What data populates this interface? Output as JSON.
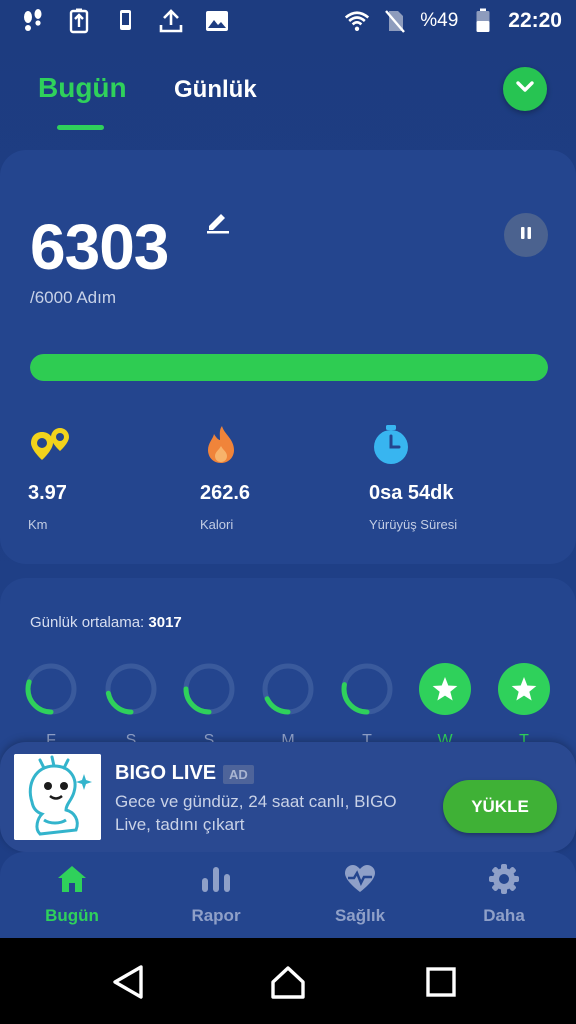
{
  "status_bar": {
    "battery_percent": "%49",
    "time": "22:20",
    "icons": [
      "footsteps-icon",
      "battery-saver-icon",
      "device-icon",
      "upload-icon",
      "image-icon",
      "wifi-icon",
      "no-sim-icon",
      "battery-icon"
    ]
  },
  "tabs": {
    "today": "Bugün",
    "daily": "Günlük"
  },
  "steps": {
    "value": "6303",
    "goal": "/6000 Adım",
    "progress_fraction": 1.0
  },
  "stats": {
    "distance": {
      "value": "3.97",
      "label": "Km",
      "icon": "location-pins-icon"
    },
    "calories": {
      "value": "262.6",
      "label": "Kalori",
      "icon": "flame-icon"
    },
    "walk_time": {
      "value": "0sa 54dk",
      "label": "Yürüyüş Süresi",
      "icon": "stopwatch-icon"
    }
  },
  "average": {
    "label": "Günlük ortalama:",
    "value": "3017"
  },
  "week": [
    {
      "letter": "F",
      "fraction": 0.3,
      "complete": false
    },
    {
      "letter": "S",
      "fraction": 0.22,
      "complete": false
    },
    {
      "letter": "S",
      "fraction": 0.25,
      "complete": false
    },
    {
      "letter": "M",
      "fraction": 0.18,
      "complete": false
    },
    {
      "letter": "T",
      "fraction": 0.28,
      "complete": false
    },
    {
      "letter": "W",
      "fraction": 1.0,
      "complete": true
    },
    {
      "letter": "T",
      "fraction": 1.0,
      "complete": true
    }
  ],
  "ad": {
    "title": "BIGO LIVE",
    "badge": "AD",
    "description": "Gece ve gündüz, 24 saat canlı, BIGO Live, tadını çıkart",
    "cta": "YÜKLE"
  },
  "bottom_nav": [
    {
      "label": "Bugün",
      "icon": "home-icon",
      "active": true
    },
    {
      "label": "Rapor",
      "icon": "bar-chart-icon",
      "active": false
    },
    {
      "label": "Sağlık",
      "icon": "heart-pulse-icon",
      "active": false
    },
    {
      "label": "Daha",
      "icon": "gear-icon",
      "active": false
    }
  ],
  "colors": {
    "accent_green": "#2fd15b",
    "background": "#1d3c80",
    "card": "#24458e"
  }
}
